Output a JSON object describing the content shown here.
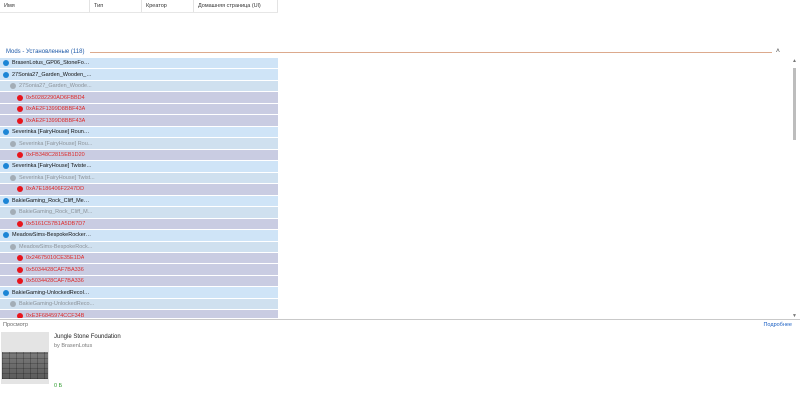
{
  "columns": {
    "name": "Имя",
    "type": "Тип",
    "creator": "Креатор",
    "homepage": "Домашняя страница (Ul)"
  },
  "group": {
    "title": "Mods - Установленные",
    "count": "(118)",
    "chevron_icon": "chevron-up-icon"
  },
  "rows": [
    {
      "level": 0,
      "label": "BrasenLotus_GP06_StoneFoun..."
    },
    {
      "level": 0,
      "label": "27Sonia27_Garden_Wooden_Pot"
    },
    {
      "level": 1,
      "label": "27Sonia27_Garden_Woode..."
    },
    {
      "level": 2,
      "label": "0x50282290AD6FBBD4"
    },
    {
      "level": 2,
      "label": "0xAE2F1399D8BBF43A"
    },
    {
      "level": 2,
      "label": "0xAE2F1399D8BBF43A"
    },
    {
      "level": 0,
      "label": "Severinka [FairyHouse] Round ..."
    },
    {
      "level": 1,
      "label": "Severinka [FairyHouse] Rou..."
    },
    {
      "level": 2,
      "label": "0xFB348C2815EB1D20"
    },
    {
      "level": 0,
      "label": "Severinka [FairyHouse] Twisted..."
    },
    {
      "level": 1,
      "label": "Severinka [FairyHouse] Twist..."
    },
    {
      "level": 2,
      "label": "0xA7E186406F2247DD"
    },
    {
      "level": 0,
      "label": "BakieGaming_Rock_Cliff_Medi..."
    },
    {
      "level": 1,
      "label": "BakieGaming_Rock_Cliff_M..."
    },
    {
      "level": 2,
      "label": "0x5161C57B1A5DB7D7"
    },
    {
      "level": 0,
      "label": "MeadowSims-BespokeRocker (1)"
    },
    {
      "level": 1,
      "label": "MeadowSims-BespokeRock..."
    },
    {
      "level": 2,
      "label": "0x24675010CE35E1DA"
    },
    {
      "level": 2,
      "label": "0x5034428CAF7BA336"
    },
    {
      "level": 2,
      "label": "0x5034428CAF7BA336"
    },
    {
      "level": 0,
      "label": "BakieGaming-UnlockedRecolor..."
    },
    {
      "level": 1,
      "label": "BakieGaming-UnlockedReco..."
    },
    {
      "level": 2,
      "label": "0xE3F6845974CCF34B"
    }
  ],
  "preview": {
    "label": "Просмотр",
    "details_link": "Подробнее",
    "title": "Jungle Stone Foundation",
    "creator": "by BrasenLotus",
    "size": "0 Б"
  },
  "colors": {
    "row_top": "#cfe4f7",
    "row_child": "#cfe0ef",
    "row_resource": "#c9cce2",
    "dot_mod": "#1d86d6",
    "dot_file": "#a3adb6",
    "dot_resource": "#e8141c",
    "link": "#1e62c4",
    "size_text": "#2d9b2d"
  }
}
